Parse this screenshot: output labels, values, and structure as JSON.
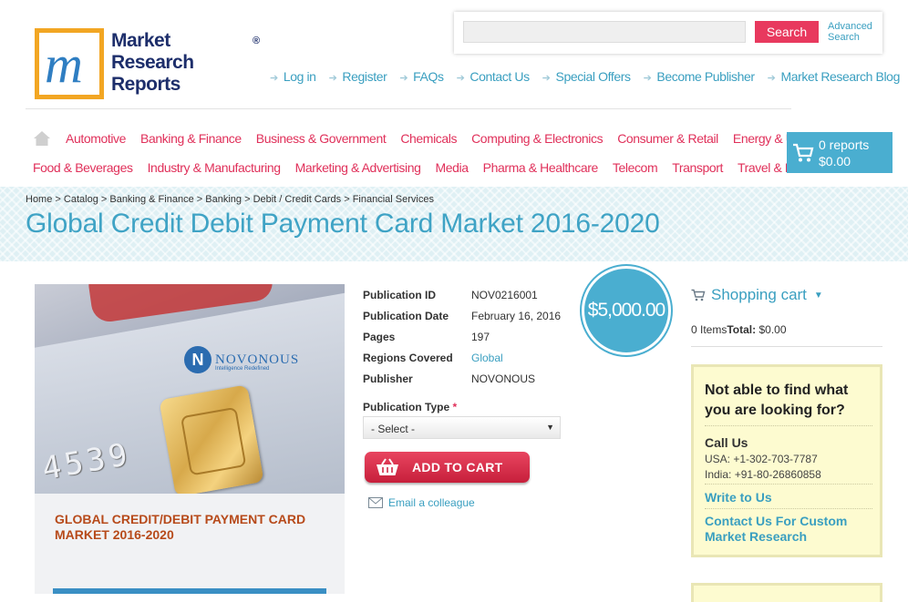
{
  "logo": {
    "line1": "Market",
    "line2": "Research",
    "line3": "Reports",
    "reg": "®",
    "mark": "m"
  },
  "search": {
    "placeholder": "",
    "button": "Search",
    "advanced_line1": "Advanced",
    "advanced_line2": "Search"
  },
  "top_links": [
    "Log in",
    "Register",
    "FAQs",
    "Contact Us",
    "Special Offers",
    "Become Publisher",
    "Market Research Blog"
  ],
  "categories_row1": [
    "Automotive",
    "Banking & Finance",
    "Business & Government",
    "Chemicals",
    "Computing & Electronics",
    "Consumer & Retail",
    "Energy & Utilities"
  ],
  "categories_row2": [
    "Food & Beverages",
    "Industry & Manufacturing",
    "Marketing & Advertising",
    "Media",
    "Pharma & Healthcare",
    "Telecom",
    "Transport",
    "Travel & Leisure"
  ],
  "header_cart": {
    "reports": "0 reports",
    "total": "$0.00"
  },
  "breadcrumb": [
    "Home",
    "Catalog",
    "Banking & Finance",
    "Banking",
    "Debit / Credit Cards",
    "Financial Services"
  ],
  "breadcrumb_sep": " > ",
  "page_title": "Global Credit Debit Payment Card Market 2016-2020",
  "product_image": {
    "publisher_logo": "NOVONOUS",
    "publisher_logo_letter": "N",
    "publisher_tagline": "Intelligence Redefined",
    "card_numbers": "4539",
    "cover_line1": "GLOBAL CREDIT/DEBIT PAYMENT CARD",
    "cover_line2": "MARKET 2016-2020"
  },
  "details": [
    {
      "label": "Publication ID",
      "value": "NOV0216001",
      "link": false
    },
    {
      "label": "Publication Date",
      "value": "February 16, 2016",
      "link": false
    },
    {
      "label": "Pages",
      "value": "197",
      "link": false
    },
    {
      "label": "Regions Covered",
      "value": "Global",
      "link": true
    },
    {
      "label": "Publisher",
      "value": "NOVONOUS",
      "link": false
    }
  ],
  "publication_type": {
    "label": "Publication Type",
    "required_mark": "*",
    "selected": "- Select -"
  },
  "add_to_cart": "ADD TO CART",
  "email_colleague": "Email a colleague",
  "price": "$5,000.00",
  "shopping_cart": {
    "title": "Shopping cart",
    "items": "0 Items",
    "total_label": "Total:",
    "total_value": "$0.00"
  },
  "help": {
    "question": "Not able to find what you are looking for?",
    "call_us": "Call Us",
    "usa": "USA: +1-302-703-7787",
    "india": "India: +91-80-26860858",
    "write_to_us": "Write to Us",
    "custom_research": "Contact Us For Custom Market Research"
  },
  "colors": {
    "accent_blue": "#4aaed0",
    "link_blue": "#3a9fc0",
    "category_pink": "#e0305a",
    "title_blue": "#3fa3c5"
  }
}
